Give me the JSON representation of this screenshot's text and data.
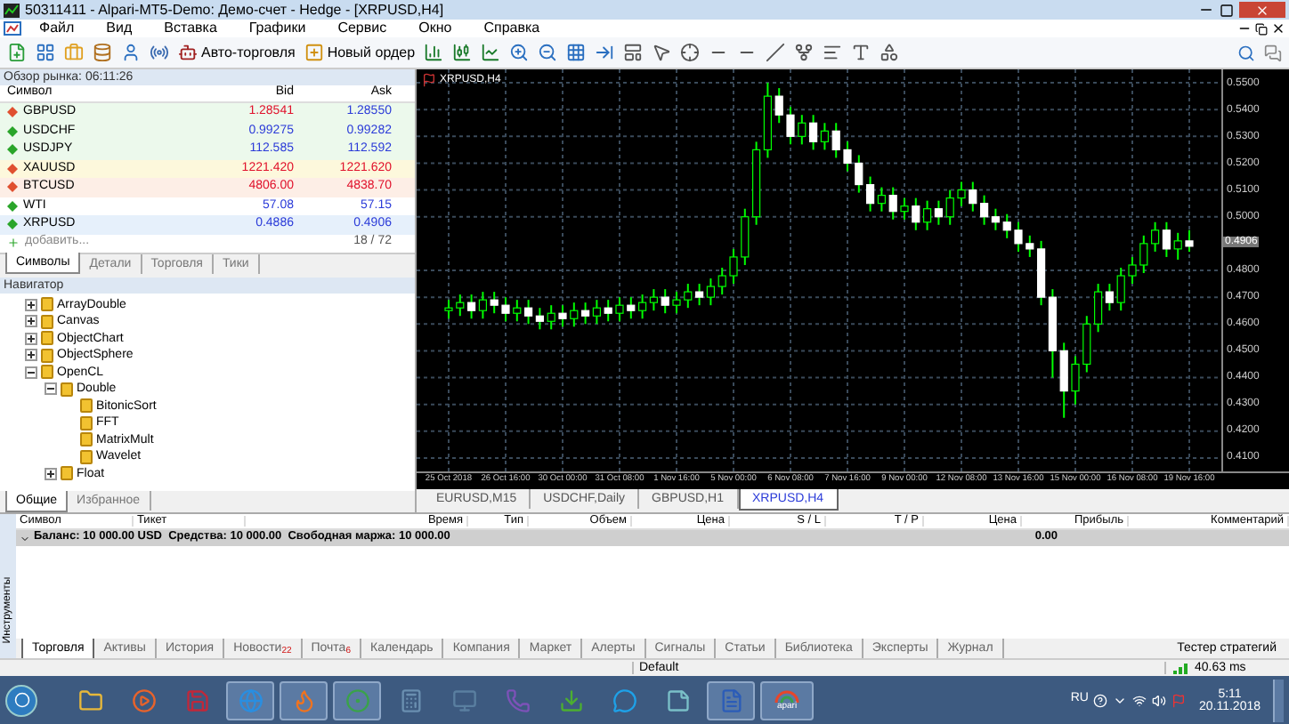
{
  "window": {
    "title": "50311411 - Alpari-MT5-Demo: Демо-счет - Hedge - [XRPUSD,H4]"
  },
  "menu": [
    "Файл",
    "Вид",
    "Вставка",
    "Графики",
    "Сервис",
    "Окно",
    "Справка"
  ],
  "toolbar": {
    "auto_trading": "Авто-торговля",
    "new_order": "Новый ордер"
  },
  "market_watch": {
    "title": "Обзор рынка: 06:11:26",
    "columns": [
      "Символ",
      "Bid",
      "Ask"
    ],
    "rows": [
      {
        "symbol": "GBPUSD",
        "bid": "1.28541",
        "ask": "1.28550",
        "rising": false,
        "bid_up": false,
        "ask_up": true,
        "color": "#ecf9ec"
      },
      {
        "symbol": "USDCHF",
        "bid": "0.99275",
        "ask": "0.99282",
        "rising": true,
        "bid_up": true,
        "ask_up": true,
        "color": "#ecf9ec"
      },
      {
        "symbol": "USDJPY",
        "bid": "112.585",
        "ask": "112.592",
        "rising": true,
        "bid_up": true,
        "ask_up": true,
        "color": "#ecf9ec"
      },
      {
        "symbol": "XAUUSD",
        "bid": "1221.420",
        "ask": "1221.620",
        "rising": false,
        "bid_up": false,
        "ask_up": false,
        "color": "#fdf8dc"
      },
      {
        "symbol": "BTCUSD",
        "bid": "4806.00",
        "ask": "4838.70",
        "rising": false,
        "bid_up": false,
        "ask_up": false,
        "color": "#fdeee6"
      },
      {
        "symbol": "WTI",
        "bid": "57.08",
        "ask": "57.15",
        "rising": true,
        "bid_up": true,
        "ask_up": true,
        "color": "#ffffff"
      },
      {
        "symbol": "XRPUSD",
        "bid": "0.4886",
        "ask": "0.4906",
        "rising": true,
        "bid_up": true,
        "ask_up": true,
        "color": "#e6f0fb"
      }
    ],
    "add_label": "добавить...",
    "count": "18 / 72",
    "tabs": [
      {
        "label": "Символы",
        "selected": true
      },
      {
        "label": "Детали",
        "selected": false
      },
      {
        "label": "Торговля",
        "selected": false
      },
      {
        "label": "Тики",
        "selected": false
      }
    ]
  },
  "navigator": {
    "title": "Навигатор",
    "tree": [
      {
        "label": "ArrayDouble",
        "expanded": false
      },
      {
        "label": "Canvas",
        "expanded": false
      },
      {
        "label": "ObjectChart",
        "expanded": false
      },
      {
        "label": "ObjectSphere",
        "expanded": false
      },
      {
        "label": "OpenCL",
        "expanded": true,
        "children": [
          {
            "label": "Double",
            "expanded": true,
            "children": [
              {
                "label": "BitonicSort"
              },
              {
                "label": "FFT"
              },
              {
                "label": "MatrixMult"
              },
              {
                "label": "Wavelet"
              }
            ]
          },
          {
            "label": "Float",
            "expanded": false
          }
        ]
      }
    ],
    "tabs": [
      {
        "label": "Общие",
        "selected": true
      },
      {
        "label": "Избранное",
        "selected": false
      }
    ]
  },
  "chart": {
    "title": "XRPUSD,H4",
    "current_price": "0.4906",
    "chart_data": {
      "type": "candlestick",
      "categories": [
        "25 Oct 2018",
        null,
        null,
        null,
        null,
        "26 Oct 16:00",
        null,
        null,
        null,
        null,
        "30 Oct 00:00",
        null,
        null,
        null,
        null,
        "31 Oct 08:00",
        null,
        null,
        null,
        null,
        "1 Nov 16:00",
        null,
        null,
        null,
        null,
        "5 Nov 00:00",
        null,
        null,
        null,
        null,
        "6 Nov 08:00",
        null,
        null,
        null,
        null,
        "7 Nov 16:00",
        null,
        null,
        null,
        null,
        "9 Nov 00:00",
        null,
        null,
        null,
        null,
        "12 Nov 08:00",
        null,
        null,
        null,
        null,
        "13 Nov 16:00",
        null,
        null,
        null,
        null,
        "15 Nov 00:00",
        null,
        null,
        null,
        null,
        "16 Nov 08:00",
        null,
        null,
        null,
        null,
        "19 Nov 16:00"
      ],
      "ohlc": [
        [
          0.465,
          0.469,
          0.462,
          0.466
        ],
        [
          0.466,
          0.471,
          0.463,
          0.468
        ],
        [
          0.468,
          0.471,
          0.462,
          0.465
        ],
        [
          0.465,
          0.472,
          0.462,
          0.469
        ],
        [
          0.469,
          0.472,
          0.464,
          0.467
        ],
        [
          0.467,
          0.47,
          0.461,
          0.464
        ],
        [
          0.464,
          0.469,
          0.461,
          0.466
        ],
        [
          0.466,
          0.469,
          0.46,
          0.463
        ],
        [
          0.463,
          0.466,
          0.458,
          0.461
        ],
        [
          0.461,
          0.467,
          0.458,
          0.464
        ],
        [
          0.464,
          0.467,
          0.459,
          0.462
        ],
        [
          0.462,
          0.468,
          0.459,
          0.465
        ],
        [
          0.465,
          0.468,
          0.46,
          0.463
        ],
        [
          0.463,
          0.469,
          0.46,
          0.466
        ],
        [
          0.466,
          0.469,
          0.461,
          0.464
        ],
        [
          0.464,
          0.47,
          0.461,
          0.467
        ],
        [
          0.467,
          0.47,
          0.462,
          0.465
        ],
        [
          0.465,
          0.471,
          0.462,
          0.468
        ],
        [
          0.468,
          0.473,
          0.465,
          0.47
        ],
        [
          0.47,
          0.473,
          0.464,
          0.467
        ],
        [
          0.467,
          0.472,
          0.464,
          0.469
        ],
        [
          0.469,
          0.475,
          0.466,
          0.472
        ],
        [
          0.472,
          0.475,
          0.467,
          0.47
        ],
        [
          0.47,
          0.477,
          0.467,
          0.474
        ],
        [
          0.474,
          0.481,
          0.471,
          0.478
        ],
        [
          0.478,
          0.488,
          0.475,
          0.485
        ],
        [
          0.485,
          0.503,
          0.482,
          0.5
        ],
        [
          0.5,
          0.528,
          0.497,
          0.525
        ],
        [
          0.525,
          0.55,
          0.522,
          0.545
        ],
        [
          0.545,
          0.548,
          0.535,
          0.538
        ],
        [
          0.538,
          0.541,
          0.527,
          0.53
        ],
        [
          0.53,
          0.538,
          0.527,
          0.535
        ],
        [
          0.535,
          0.538,
          0.525,
          0.528
        ],
        [
          0.528,
          0.535,
          0.525,
          0.532
        ],
        [
          0.532,
          0.535,
          0.522,
          0.525
        ],
        [
          0.525,
          0.528,
          0.517,
          0.52
        ],
        [
          0.52,
          0.523,
          0.509,
          0.512
        ],
        [
          0.512,
          0.515,
          0.502,
          0.505
        ],
        [
          0.505,
          0.511,
          0.502,
          0.508
        ],
        [
          0.508,
          0.511,
          0.499,
          0.502
        ],
        [
          0.502,
          0.507,
          0.499,
          0.504
        ],
        [
          0.504,
          0.507,
          0.495,
          0.498
        ],
        [
          0.498,
          0.506,
          0.495,
          0.503
        ],
        [
          0.503,
          0.506,
          0.497,
          0.5
        ],
        [
          0.5,
          0.51,
          0.497,
          0.507
        ],
        [
          0.507,
          0.513,
          0.504,
          0.51
        ],
        [
          0.51,
          0.513,
          0.502,
          0.505
        ],
        [
          0.505,
          0.508,
          0.497,
          0.5
        ],
        [
          0.5,
          0.503,
          0.495,
          0.498
        ],
        [
          0.498,
          0.501,
          0.492,
          0.495
        ],
        [
          0.495,
          0.498,
          0.487,
          0.49
        ],
        [
          0.49,
          0.493,
          0.485,
          0.488
        ],
        [
          0.488,
          0.491,
          0.467,
          0.47
        ],
        [
          0.47,
          0.473,
          0.44,
          0.45
        ],
        [
          0.45,
          0.453,
          0.425,
          0.435
        ],
        [
          0.435,
          0.448,
          0.43,
          0.445
        ],
        [
          0.445,
          0.463,
          0.442,
          0.46
        ],
        [
          0.46,
          0.475,
          0.457,
          0.472
        ],
        [
          0.472,
          0.475,
          0.465,
          0.468
        ],
        [
          0.468,
          0.481,
          0.465,
          0.478
        ],
        [
          0.478,
          0.485,
          0.475,
          0.482
        ],
        [
          0.482,
          0.493,
          0.479,
          0.49
        ],
        [
          0.49,
          0.498,
          0.487,
          0.495
        ],
        [
          0.495,
          0.498,
          0.485,
          0.488
        ],
        [
          0.488,
          0.494,
          0.484,
          0.491
        ],
        [
          0.491,
          0.495,
          0.487,
          0.489
        ]
      ],
      "ylim": [
        0.405,
        0.555
      ],
      "yticks": [
        {
          "value": 0.55,
          "label": "0.5500"
        },
        {
          "value": 0.54,
          "label": "0.5400"
        },
        {
          "value": 0.53,
          "label": "0.5300"
        },
        {
          "value": 0.52,
          "label": "0.5200"
        },
        {
          "value": 0.51,
          "label": "0.5100"
        },
        {
          "value": 0.5,
          "label": "0.5000"
        },
        {
          "value": 0.48,
          "label": "0.4800"
        },
        {
          "value": 0.47,
          "label": "0.4700"
        },
        {
          "value": 0.46,
          "label": "0.4600"
        },
        {
          "value": 0.45,
          "label": "0.4500"
        },
        {
          "value": 0.44,
          "label": "0.4400"
        },
        {
          "value": 0.43,
          "label": "0.4300"
        },
        {
          "value": 0.42,
          "label": "0.4200"
        },
        {
          "value": 0.41,
          "label": "0.4100"
        }
      ],
      "grid": true
    },
    "tabs": [
      {
        "label": "EURUSD,M15",
        "selected": false
      },
      {
        "label": "USDCHF,Daily",
        "selected": false
      },
      {
        "label": "GBPUSD,H1",
        "selected": false
      },
      {
        "label": "XRPUSD,H4",
        "selected": true
      }
    ]
  },
  "toolbox": {
    "side_label": "Инструменты",
    "columns": [
      "Символ",
      "Тикет",
      "Время",
      "Тип",
      "Объем",
      "Цена",
      "S / L",
      "T / P",
      "Цена",
      "Прибыль",
      "Комментарий"
    ],
    "balance": "Баланс: 10 000.00 USD  Средства: 10 000.00  Свободная маржа: 10 000.00",
    "profit": "0.00",
    "tabs": [
      {
        "label": "Торговля",
        "selected": true
      },
      {
        "label": "Активы",
        "selected": false
      },
      {
        "label": "История",
        "selected": false
      },
      {
        "label": "Новости",
        "badge": "22",
        "selected": false
      },
      {
        "label": "Почта",
        "badge": "6",
        "selected": false
      },
      {
        "label": "Календарь",
        "selected": false
      },
      {
        "label": "Компания",
        "selected": false
      },
      {
        "label": "Маркет",
        "selected": false
      },
      {
        "label": "Алерты",
        "selected": false
      },
      {
        "label": "Сигналы",
        "selected": false
      },
      {
        "label": "Статьи",
        "selected": false
      },
      {
        "label": "Библиотека",
        "selected": false
      },
      {
        "label": "Эксперты",
        "selected": false
      },
      {
        "label": "Журнал",
        "selected": false
      }
    ],
    "tester": "Тестер стратегий"
  },
  "status_bar": {
    "profile": "Default",
    "ping": "40.63 ms"
  },
  "taskbar": {
    "app_label": "apari",
    "language": "RU",
    "time": "5:11",
    "date": "20.11.2018"
  }
}
